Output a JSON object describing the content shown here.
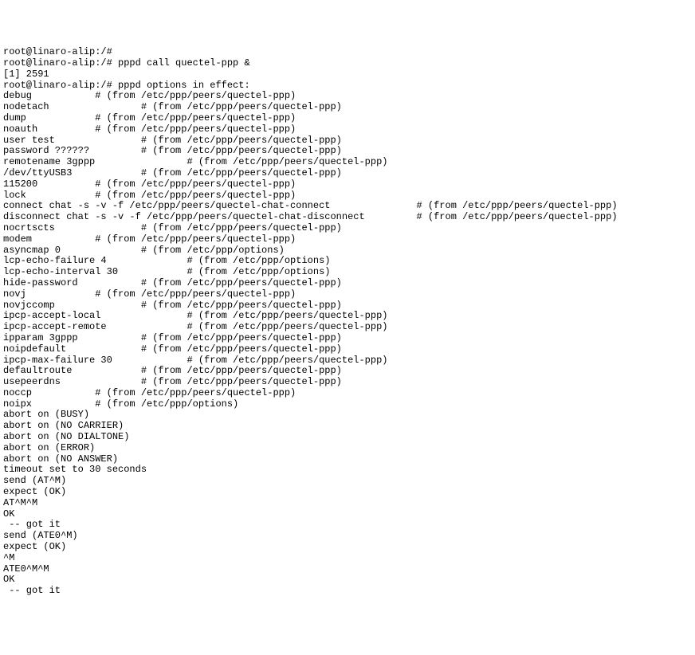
{
  "lines": [
    "root@linaro-alip:/#",
    "root@linaro-alip:/# pppd call quectel-ppp &",
    "[1] 2591",
    "root@linaro-alip:/# pppd options in effect:",
    "debug           # (from /etc/ppp/peers/quectel-ppp)",
    "nodetach                # (from /etc/ppp/peers/quectel-ppp)",
    "dump            # (from /etc/ppp/peers/quectel-ppp)",
    "noauth          # (from /etc/ppp/peers/quectel-ppp)",
    "user test               # (from /etc/ppp/peers/quectel-ppp)",
    "password ??????         # (from /etc/ppp/peers/quectel-ppp)",
    "remotename 3gppp                # (from /etc/ppp/peers/quectel-ppp)",
    "/dev/ttyUSB3            # (from /etc/ppp/peers/quectel-ppp)",
    "115200          # (from /etc/ppp/peers/quectel-ppp)",
    "lock            # (from /etc/ppp/peers/quectel-ppp)",
    "connect chat -s -v -f /etc/ppp/peers/quectel-chat-connect               # (from /etc/ppp/peers/quectel-ppp)",
    "disconnect chat -s -v -f /etc/ppp/peers/quectel-chat-disconnect         # (from /etc/ppp/peers/quectel-ppp)",
    "nocrtscts               # (from /etc/ppp/peers/quectel-ppp)",
    "modem           # (from /etc/ppp/peers/quectel-ppp)",
    "asyncmap 0              # (from /etc/ppp/options)",
    "lcp-echo-failure 4              # (from /etc/ppp/options)",
    "lcp-echo-interval 30            # (from /etc/ppp/options)",
    "hide-password           # (from /etc/ppp/peers/quectel-ppp)",
    "novj            # (from /etc/ppp/peers/quectel-ppp)",
    "novjccomp               # (from /etc/ppp/peers/quectel-ppp)",
    "ipcp-accept-local               # (from /etc/ppp/peers/quectel-ppp)",
    "ipcp-accept-remote              # (from /etc/ppp/peers/quectel-ppp)",
    "ipparam 3gppp           # (from /etc/ppp/peers/quectel-ppp)",
    "noipdefault             # (from /etc/ppp/peers/quectel-ppp)",
    "ipcp-max-failure 30             # (from /etc/ppp/peers/quectel-ppp)",
    "defaultroute            # (from /etc/ppp/peers/quectel-ppp)",
    "usepeerdns              # (from /etc/ppp/peers/quectel-ppp)",
    "noccp           # (from /etc/ppp/peers/quectel-ppp)",
    "noipx           # (from /etc/ppp/options)",
    "abort on (BUSY)",
    "abort on (NO CARRIER)",
    "abort on (NO DIALTONE)",
    "abort on (ERROR)",
    "abort on (NO ANSWER)",
    "timeout set to 30 seconds",
    "send (AT^M)",
    "expect (OK)",
    "AT^M^M",
    "OK",
    " -- got it",
    "",
    "send (ATE0^M)",
    "expect (OK)",
    "^M",
    "ATE0^M^M",
    "OK",
    " -- got it"
  ]
}
